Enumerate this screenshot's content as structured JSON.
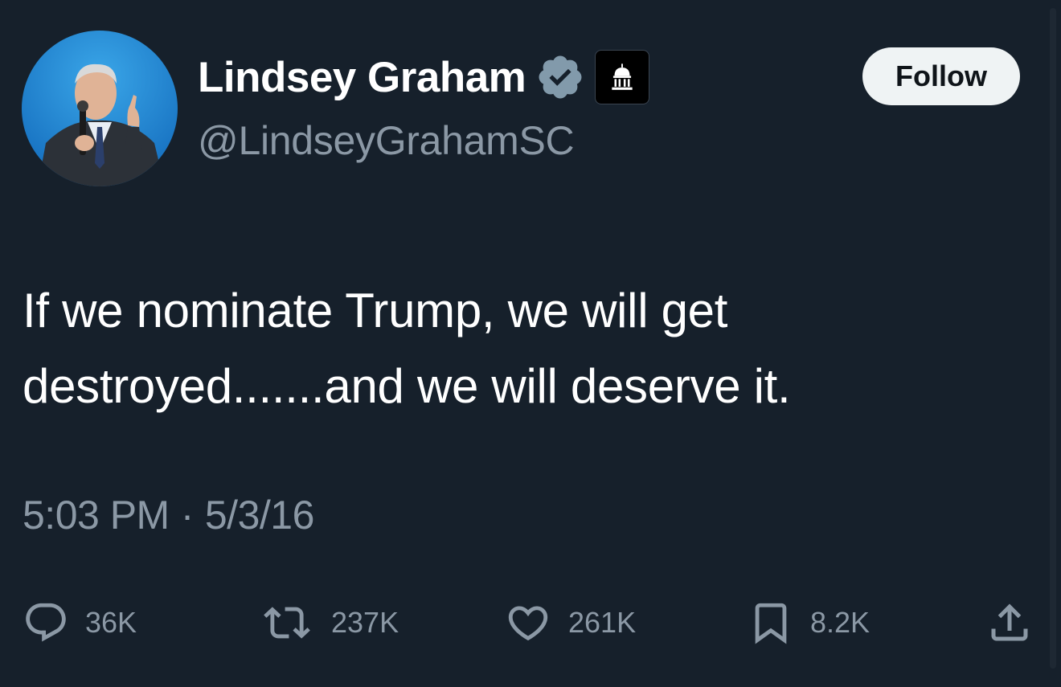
{
  "author": {
    "name": "Lindsey Graham",
    "handle": "@LindseyGrahamSC",
    "verified_badge_color": "#829aab"
  },
  "follow_button": {
    "label": "Follow"
  },
  "tweet": {
    "text": "If we nominate Trump, we will get destroyed.......and we will deserve it.",
    "time": "5:03 PM",
    "separator": "·",
    "date": "5/3/16"
  },
  "actions": {
    "replies": {
      "icon": "reply-icon",
      "count": "36K"
    },
    "reposts": {
      "icon": "repost-icon",
      "count": "237K"
    },
    "likes": {
      "icon": "heart-icon",
      "count": "261K"
    },
    "bookmarks": {
      "icon": "bookmark-icon",
      "count": "8.2K"
    },
    "share": {
      "icon": "share-icon"
    }
  },
  "colors": {
    "background": "#16202b",
    "text_primary": "#ffffff",
    "text_secondary": "#8b98a5",
    "button_bg": "#eff3f4"
  }
}
